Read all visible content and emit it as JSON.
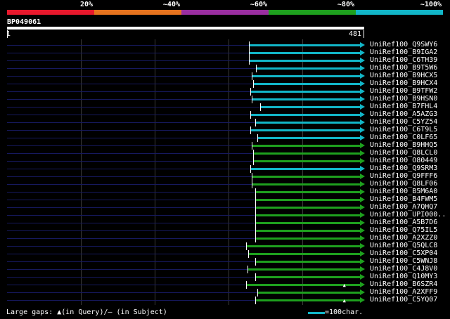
{
  "legend": {
    "labels": [
      "20%",
      "~40%",
      "~60%",
      "~80%",
      "~100%"
    ],
    "colors": [
      "#e8182c",
      "#e6731e",
      "#9a2ea0",
      "#1ea01e",
      "#12b6c8"
    ]
  },
  "query": {
    "id": "BP049061",
    "start_label": "1",
    "end_label": "481",
    "length": 481
  },
  "hits": [
    {
      "name": "UniRef100_Q9SWY6",
      "start": 327,
      "color": "#12b6c8"
    },
    {
      "name": "UniRef100_B9IGA2",
      "start": 327,
      "color": "#12b6c8"
    },
    {
      "name": "UniRef100_C6TH39",
      "start": 327,
      "color": "#12b6c8"
    },
    {
      "name": "UniRef100_B9T5W6",
      "start": 336,
      "color": "#12b6c8"
    },
    {
      "name": "UniRef100_B9HCX5",
      "start": 330,
      "color": "#12b6c8"
    },
    {
      "name": "UniRef100_B9HCX4",
      "start": 332,
      "color": "#12b6c8"
    },
    {
      "name": "UniRef100_B9TFW2",
      "start": 329,
      "color": "#12b6c8"
    },
    {
      "name": "UniRef100_B9HSN0",
      "start": 330,
      "color": "#12b6c8"
    },
    {
      "name": "UniRef100_B7FHL4",
      "start": 342,
      "color": "#12b6c8"
    },
    {
      "name": "UniRef100_A5AZG3",
      "start": 329,
      "color": "#12b6c8"
    },
    {
      "name": "UniRef100_C5YZ54",
      "start": 335,
      "color": "#12b6c8"
    },
    {
      "name": "UniRef100_C6T9L5",
      "start": 329,
      "color": "#12b6c8"
    },
    {
      "name": "UniRef100_C0LF65",
      "start": 338,
      "color": "#12b6c8"
    },
    {
      "name": "UniRef100_B9HHQ5",
      "start": 330,
      "color": "#1ea01e"
    },
    {
      "name": "UniRef100_Q8LCL0",
      "start": 332,
      "color": "#1ea01e"
    },
    {
      "name": "UniRef100_O80449",
      "start": 332,
      "color": "#1ea01e"
    },
    {
      "name": "UniRef100_Q9SRM3",
      "start": 329,
      "color": "#12b6c8"
    },
    {
      "name": "UniRef100_Q9FFF6",
      "start": 330,
      "color": "#1ea01e"
    },
    {
      "name": "UniRef100_Q8LF06",
      "start": 330,
      "color": "#1ea01e"
    },
    {
      "name": "UniRef100_B5M6A0",
      "start": 335,
      "color": "#1ea01e"
    },
    {
      "name": "UniRef100_B4FWM5",
      "start": 335,
      "color": "#1ea01e"
    },
    {
      "name": "UniRef100_A7QHQ7",
      "start": 335,
      "color": "#1ea01e"
    },
    {
      "name": "UniRef100_UPI000..",
      "start": 335,
      "color": "#1ea01e"
    },
    {
      "name": "UniRef100_A5B7D6",
      "start": 335,
      "color": "#1ea01e"
    },
    {
      "name": "UniRef100_Q75IL5",
      "start": 335,
      "color": "#1ea01e"
    },
    {
      "name": "UniRef100_A2XZZ0",
      "start": 335,
      "color": "#1ea01e"
    },
    {
      "name": "UniRef100_Q5QLC8",
      "start": 323,
      "color": "#1ea01e"
    },
    {
      "name": "UniRef100_C5XP04",
      "start": 326,
      "color": "#1ea01e"
    },
    {
      "name": "UniRef100_C5WNJ8",
      "start": 335,
      "color": "#1ea01e"
    },
    {
      "name": "UniRef100_C4J8V0",
      "start": 325,
      "color": "#1ea01e"
    },
    {
      "name": "UniRef100_Q10MY3",
      "start": 335,
      "color": "#1ea01e"
    },
    {
      "name": "UniRef100_B6SZR4",
      "start": 323,
      "color": "#1ea01e",
      "gap_query_at": 456
    },
    {
      "name": "UniRef100_A2XFF9",
      "start": 338,
      "color": "#1ea01e"
    },
    {
      "name": "UniRef100_C5YQ07",
      "start": 335,
      "color": "#1ea01e",
      "gap_query_at": 456
    }
  ],
  "footer": {
    "gaps_text": "Large gaps: ▲(in Query)/— (in Subject)",
    "scale_text": "=100char."
  }
}
